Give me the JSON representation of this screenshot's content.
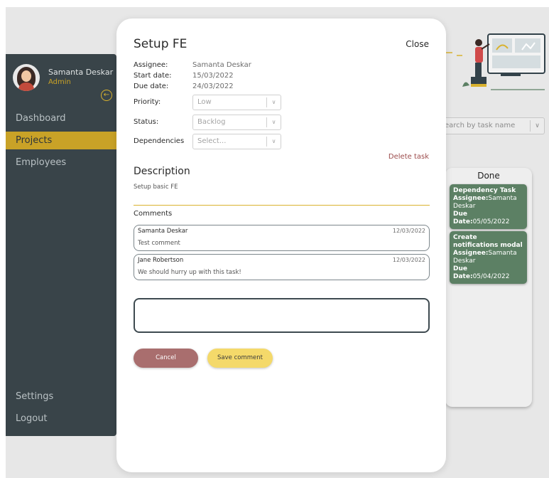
{
  "sidebar": {
    "user_name": "Samanta Deskar",
    "user_role": "Admin",
    "nav": {
      "dashboard": "Dashboard",
      "projects": "Projects",
      "employees": "Employees",
      "settings": "Settings",
      "logout": "Logout"
    }
  },
  "board": {
    "search_placeholder": "earch by task name",
    "done_column": {
      "title": "Done",
      "cards": [
        {
          "name": "Dependency Task",
          "assignee_label": "Assignee:",
          "assignee": "Samanta Deskar",
          "due_label": "Due Date:",
          "due": "05/05/2022"
        },
        {
          "name": "Create notifications modal",
          "assignee_label": "Assignee:",
          "assignee": "Samanta Deskar",
          "due_label": "Due Date:",
          "due": "05/04/2022"
        }
      ]
    }
  },
  "modal": {
    "title": "Setup FE",
    "close_label": "Close",
    "assignee_label": "Assignee:",
    "assignee": "Samanta Deskar",
    "start_label": "Start date:",
    "start": "15/03/2022",
    "due_label": "Due date:",
    "due": "24/03/2022",
    "priority_label": "Priority:",
    "priority": "Low",
    "status_label": "Status:",
    "status": "Backlog",
    "dependencies_label": "Dependencies",
    "dependencies_placeholder": "Select...",
    "delete_label": "Delete task",
    "description_title": "Description",
    "description": "Setup basic FE",
    "comments_title": "Comments",
    "comments": [
      {
        "author": "Samanta Deskar",
        "date": "12/03/2022",
        "text": "Test comment"
      },
      {
        "author": "Jane Robertson",
        "date": "12/03/2022",
        "text": "We should hurry up with this task!"
      }
    ],
    "new_comment_value": "",
    "cancel_label": "Cancel",
    "save_label": "Save comment"
  },
  "colors": {
    "sidebar_bg": "#394449",
    "accent": "#c9a227",
    "done_card": "#5c8064",
    "cancel_button": "#a96e6e",
    "save_button": "#f4d96a",
    "delete_link": "#9c4b4b"
  }
}
